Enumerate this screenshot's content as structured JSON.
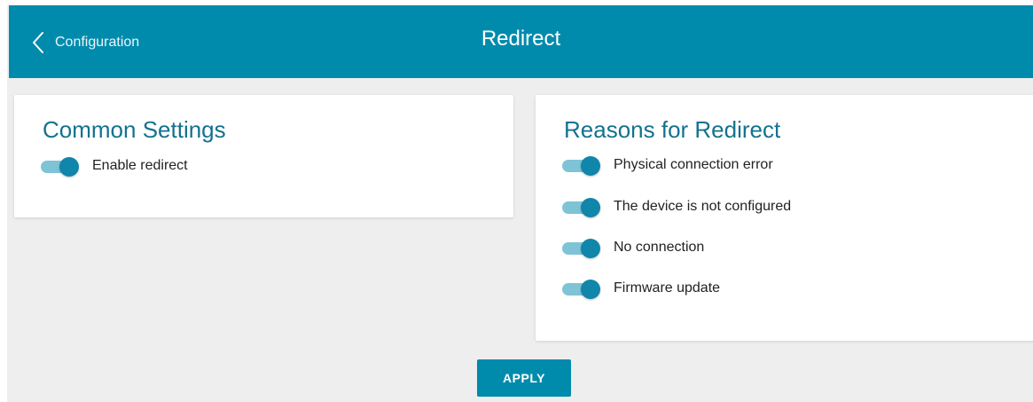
{
  "header": {
    "back_label": "Configuration",
    "title": "Redirect",
    "background_color": "#008bad",
    "back_icon": "chevron-left-icon"
  },
  "common_settings": {
    "title": "Common Settings",
    "toggles": [
      {
        "label": "Enable redirect",
        "enabled": true
      }
    ]
  },
  "reasons": {
    "title": "Reasons for Redirect",
    "toggles": [
      {
        "label": "Physical connection error",
        "enabled": true
      },
      {
        "label": "The device is not configured",
        "enabled": true
      },
      {
        "label": "No connection",
        "enabled": true
      },
      {
        "label": "Firmware update",
        "enabled": true
      }
    ]
  },
  "actions": {
    "apply_label": "APPLY"
  },
  "colors": {
    "accent": "#008bad",
    "title_text": "#14728e",
    "toggle_track": "#7fc4d6",
    "toggle_knob": "#0f86aa",
    "panel_background": "#eeeeee"
  }
}
